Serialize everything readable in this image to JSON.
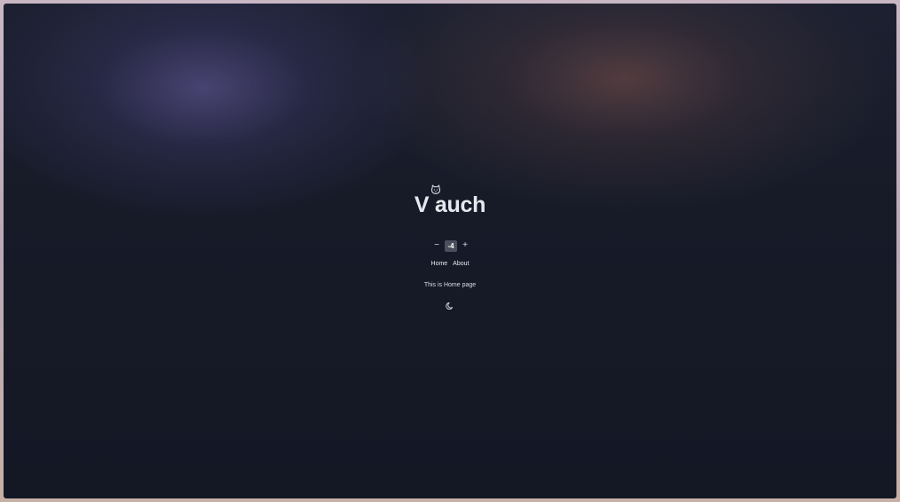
{
  "app": {
    "title": "V auch",
    "logo_icon": "cat-icon"
  },
  "counter": {
    "decrement_label": "−",
    "value": "-4",
    "increment_label": "+"
  },
  "nav": {
    "items": [
      {
        "label": "Home"
      },
      {
        "label": "About"
      }
    ]
  },
  "page": {
    "message": "This is Home page"
  },
  "theme_toggle": {
    "icon": "moon-icon"
  },
  "colors": {
    "background": "#171b28",
    "text": "#e6e8ef",
    "counter_value_bg": "#4a4f5e"
  }
}
